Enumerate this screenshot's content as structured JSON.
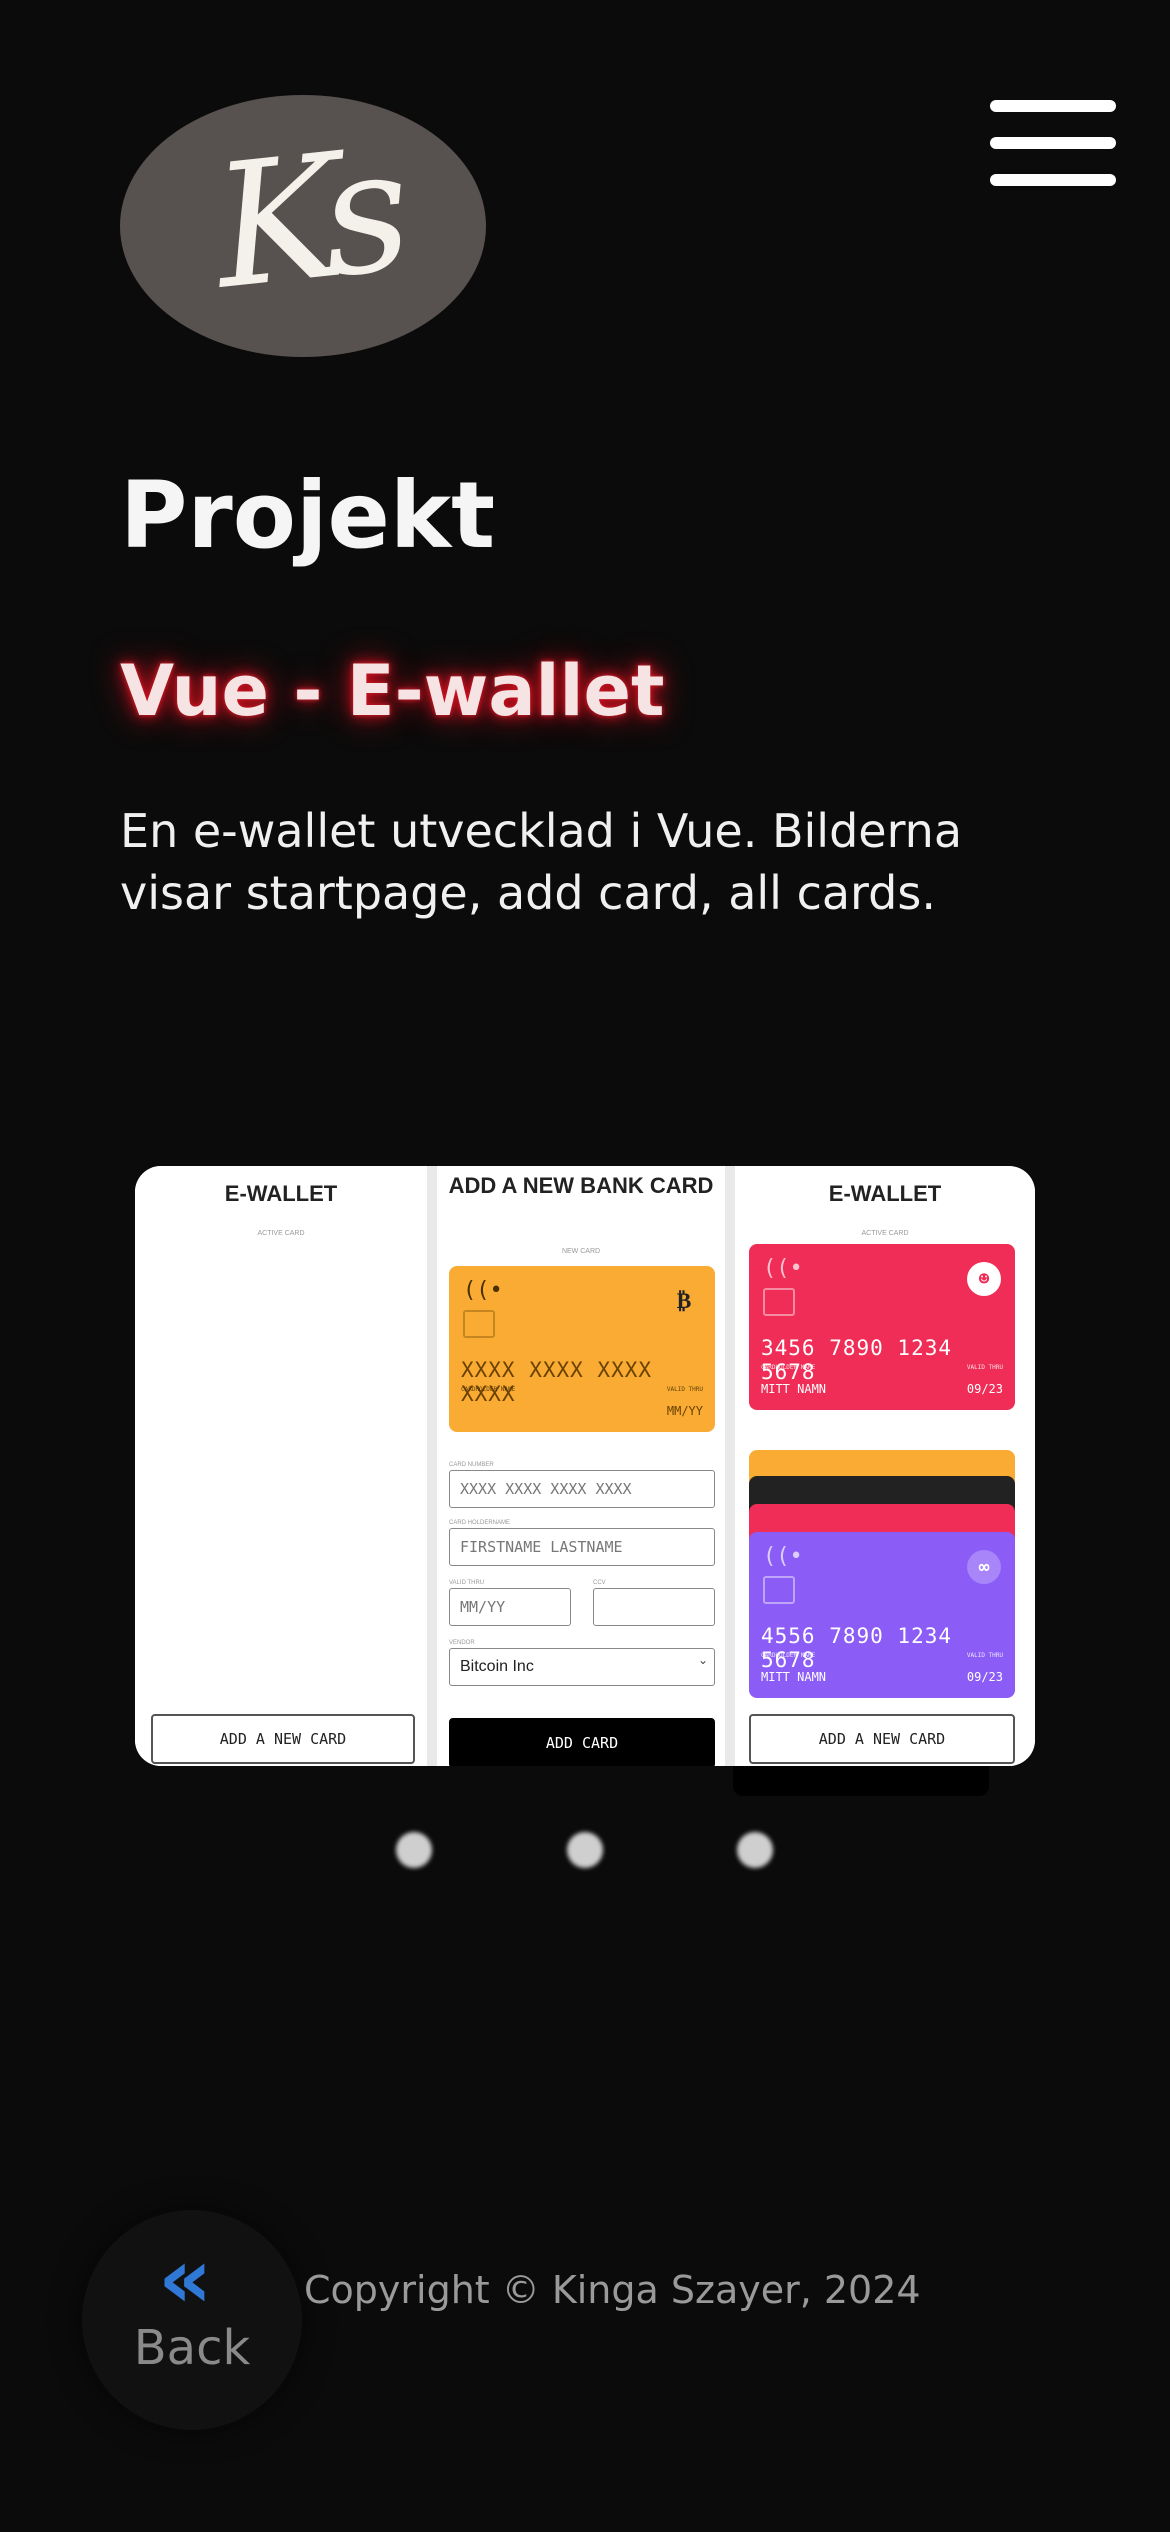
{
  "header": {
    "logo_text": "Ks",
    "menu_icon": "hamburger-menu-icon"
  },
  "main": {
    "page_title": "Projekt",
    "project_title": "Vue - E-wallet",
    "project_description": "En e-wallet utvecklad i Vue. Bilderna visar startpage, add card, all cards."
  },
  "carousel": {
    "screens": [
      {
        "title": "E-WALLET",
        "subtitle": "ACTIVE CARD",
        "button": "ADD A NEW CARD"
      },
      {
        "title": "ADD A NEW BANK CARD",
        "subtitle": "NEW CARD",
        "card": {
          "number": "XXXX XXXX XXXX XXXX",
          "holder_label": "CARDHOLDER NAME",
          "valid_label": "VALID THRU",
          "valid": "MM/YY",
          "color": "#f9ab34",
          "vendor_icon": "bitcoin-icon"
        },
        "fields": {
          "card_number_label": "CARD NUMBER",
          "card_number_placeholder": "XXXX XXXX XXXX XXXX",
          "holder_label": "CARD HOLDERNAME",
          "holder_placeholder": "FIRSTNAME LASTNAME",
          "valid_label": "VALID THRU",
          "valid_placeholder": "MM/YY",
          "ccv_label": "CCV",
          "vendor_label": "VENDOR",
          "vendor_value": "Bitcoin Inc"
        },
        "button": "ADD CARD"
      },
      {
        "title": "E-WALLET",
        "subtitle": "ACTIVE CARD",
        "active_card": {
          "number": "3456 7890 1234 5678",
          "holder_label": "CARDHOLDER NAME",
          "holder": "MITT NAMN",
          "valid_label": "VALID THRU",
          "valid": "09/23",
          "color": "#ef2d56",
          "vendor_icon": "ninja-icon"
        },
        "stacked_colors": [
          "#f9ab34",
          "#222222",
          "#ef2d56"
        ],
        "bottom_card": {
          "number": "4556 7890 1234 5678",
          "holder_label": "CARDHOLDER NAME",
          "holder": "MITT NAMN",
          "valid_label": "VALID THRU",
          "valid": "09/23",
          "color": "#8b5cf6",
          "vendor_icon": "chain-link-icon"
        },
        "button": "ADD A NEW CARD"
      }
    ],
    "dot_count": 3
  },
  "footer": {
    "back_icon": "double-chevron-left-icon",
    "back_glyph": "«",
    "back_label": "Back",
    "copyright": "Copyright © Kinga Szayer, 2024"
  }
}
